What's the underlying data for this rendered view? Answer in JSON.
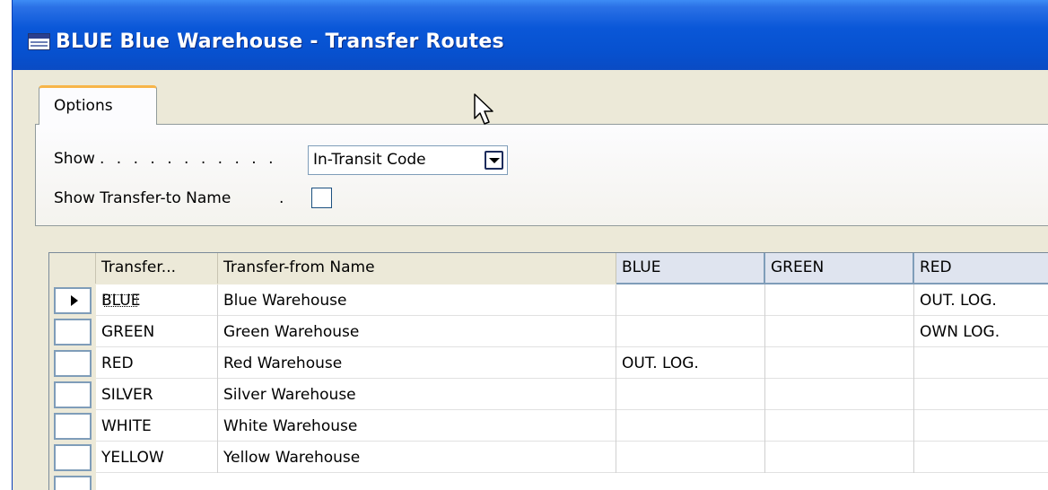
{
  "window": {
    "title": "BLUE Blue Warehouse - Transfer Routes",
    "accent_color": "#0a57d8"
  },
  "tabs": [
    {
      "label": "Options",
      "active": true
    }
  ],
  "options": {
    "show_label": "Show",
    "show_dots": ". . . . . . . . . . .",
    "show_value": "In-Transit Code",
    "show_transfer_to_name_label": "Show Transfer-to Name",
    "show_transfer_to_name_dots": ".",
    "show_transfer_to_name_checked": false
  },
  "grid": {
    "columns": [
      "Transfer...",
      "Transfer-from Name",
      "BLUE",
      "GREEN",
      "RED"
    ],
    "rows": [
      {
        "code": "BLUE",
        "name": "Blue Warehouse",
        "blue": "",
        "green": "",
        "red": "OUT. LOG.",
        "current": true
      },
      {
        "code": "GREEN",
        "name": "Green Warehouse",
        "blue": "",
        "green": "",
        "red": "OWN LOG.",
        "current": false
      },
      {
        "code": "RED",
        "name": "Red Warehouse",
        "blue": "OUT. LOG.",
        "green": "",
        "red": "",
        "current": false
      },
      {
        "code": "SILVER",
        "name": "Silver Warehouse",
        "blue": "",
        "green": "",
        "red": "",
        "current": false
      },
      {
        "code": "WHITE",
        "name": "White Warehouse",
        "blue": "",
        "green": "",
        "red": "",
        "current": false
      },
      {
        "code": "YELLOW",
        "name": "Yellow Warehouse",
        "blue": "",
        "green": "",
        "red": "",
        "current": false
      }
    ]
  },
  "icons": {
    "window": "table-icon",
    "combo": "chevron-down-icon",
    "cursor": "mouse-pointer-icon",
    "row_indicator": "triangle-right-icon"
  }
}
